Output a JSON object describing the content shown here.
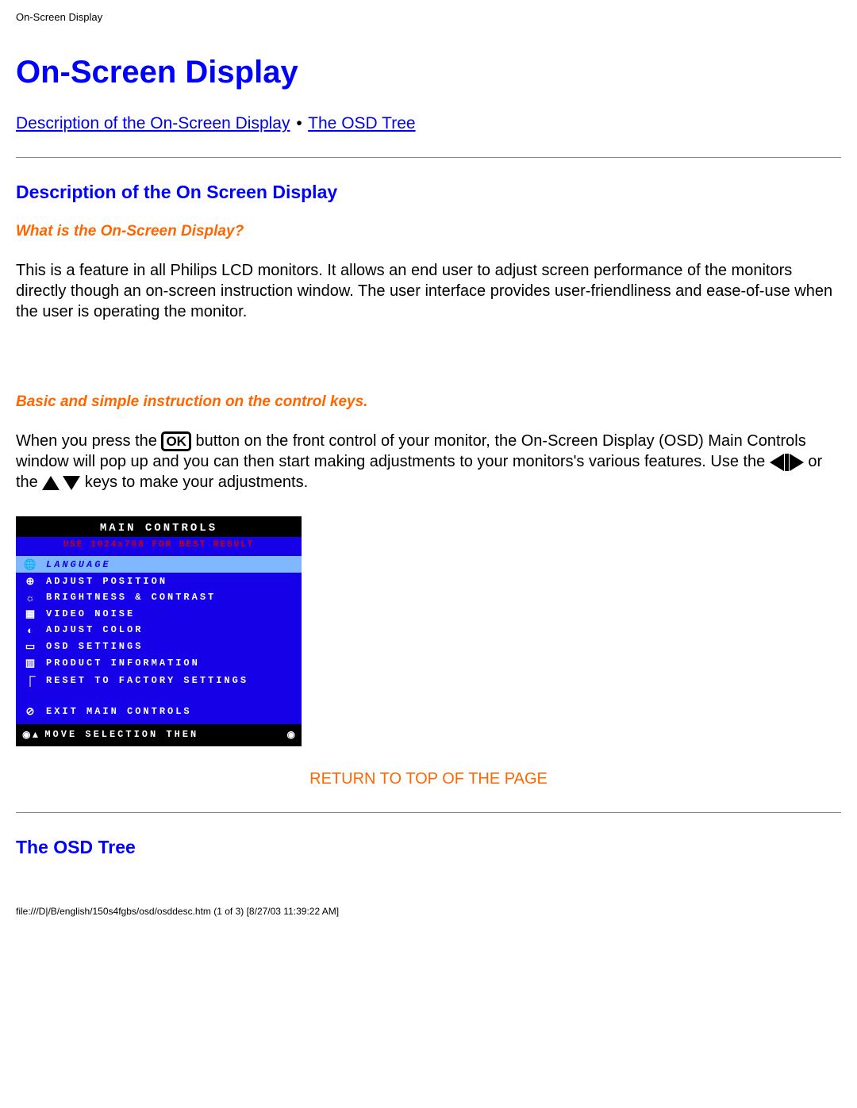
{
  "header_small": "On-Screen Display",
  "h1": "On-Screen Display",
  "nav": {
    "link1": "Description of the On-Screen Display",
    "link2": "The OSD Tree"
  },
  "section1": {
    "h2": "Description of the On Screen Display",
    "q_heading": "What is the On-Screen Display?",
    "q_body": "This is a feature in all Philips LCD monitors. It allows an end user to adjust screen performance of the monitors directly though an on-screen instruction window. The user interface provides user-friendliness and ease-of-use when the user is operating the monitor.",
    "k_heading": "Basic and simple instruction on the control keys.",
    "k_body_1": "When you press the ",
    "ok_label": "OK",
    "k_body_2": " button on the front control of your monitor, the On-Screen Display (OSD) Main Controls window will pop up and you can then start making adjustments to your monitors's various features. Use the ",
    "k_body_3": " or the ",
    "k_body_4": " keys to make your adjustments."
  },
  "osd": {
    "title": "MAIN CONTROLS",
    "hint": "USE 1024x768 FOR BEST RESULT",
    "items": [
      {
        "icon": "🌐",
        "label": "LANGUAGE",
        "highlight": true
      },
      {
        "icon": "⊕",
        "label": "ADJUST POSITION",
        "highlight": false
      },
      {
        "icon": "☼",
        "label": "BRIGHTNESS & CONTRAST",
        "highlight": false
      },
      {
        "icon": "▦",
        "label": "VIDEO NOISE",
        "highlight": false
      },
      {
        "icon": "◐",
        "label": "ADJUST COLOR",
        "highlight": false
      },
      {
        "icon": "▭",
        "label": "OSD SETTINGS",
        "highlight": false
      },
      {
        "icon": "▥",
        "label": "PRODUCT INFORMATION",
        "highlight": false
      },
      {
        "icon": "⎾",
        "label": "RESET TO FACTORY SETTINGS",
        "highlight": false
      }
    ],
    "exit": {
      "icon": "⊘",
      "label": "EXIT MAIN CONTROLS"
    },
    "footer": {
      "lead": "◉▲",
      "text": "MOVE SELECTION THEN",
      "end": "◉"
    }
  },
  "return_link": "RETURN TO TOP OF THE PAGE",
  "section2_h2": "The OSD Tree",
  "footer_path": "file:///D|/B/english/150s4fgbs/osd/osddesc.htm (1 of 3) [8/27/03 11:39:22 AM]"
}
